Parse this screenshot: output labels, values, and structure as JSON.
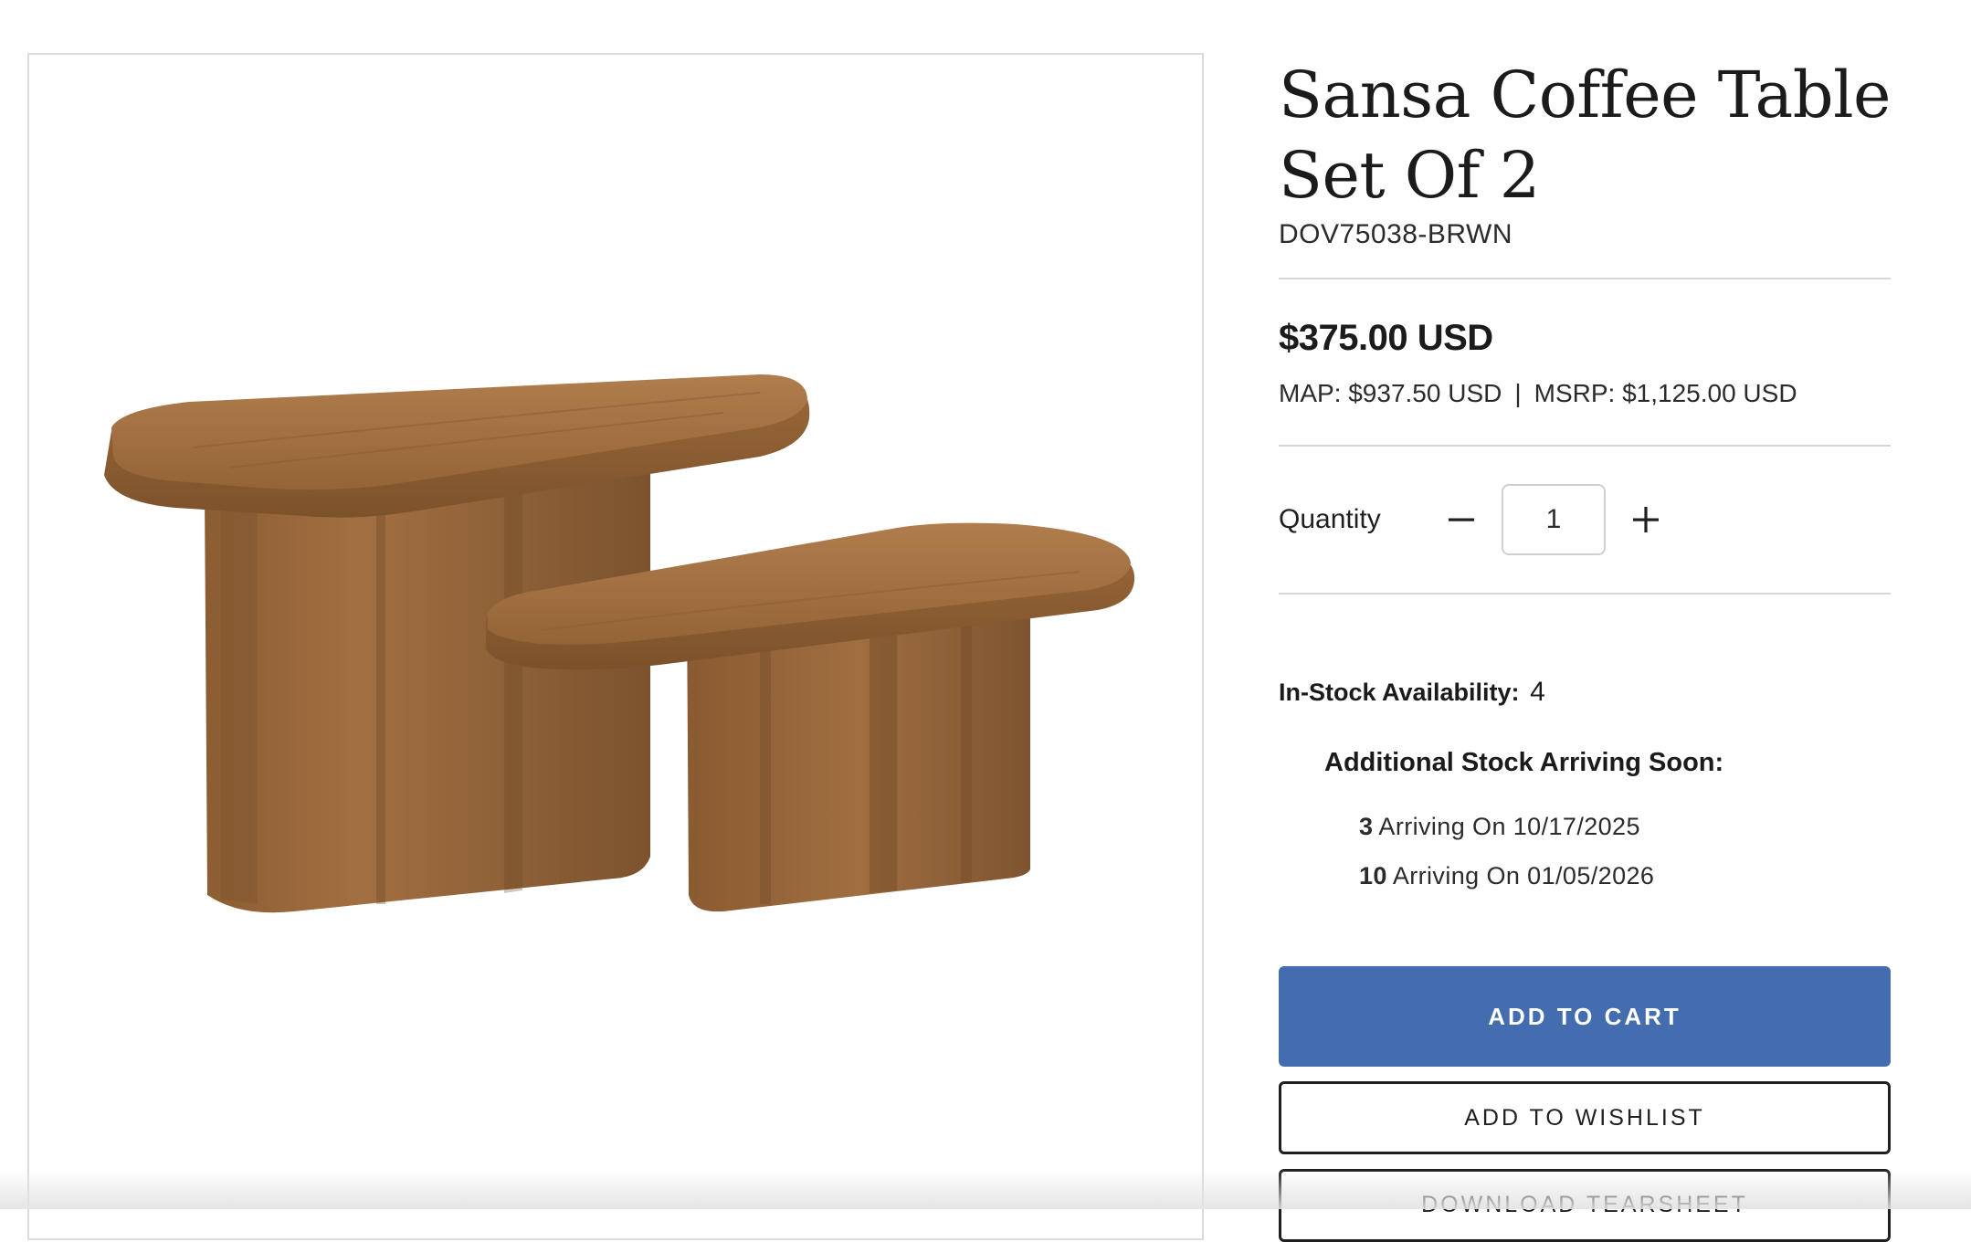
{
  "product": {
    "title": "Sansa Coffee Table Set Of 2",
    "sku": "DOV75038-BRWN",
    "price": "$375.00 USD",
    "map_price": "MAP: $937.50 USD",
    "separator": "|",
    "msrp_price": "MSRP: $1,125.00 USD"
  },
  "quantity": {
    "label": "Quantity",
    "value": "1",
    "decrease_icon": "minus-icon",
    "increase_icon": "plus-icon"
  },
  "stock": {
    "label": "In-Stock Availability:",
    "count": "4",
    "arriving_title": "Additional Stock Arriving Soon:",
    "arrivals": [
      {
        "qty": "3",
        "text": "Arriving On 10/17/2025"
      },
      {
        "qty": "10",
        "text": "Arriving On 01/05/2026"
      }
    ]
  },
  "actions": {
    "add_to_cart": "ADD TO CART",
    "add_to_wishlist": "ADD TO WISHLIST",
    "download_tearsheet": "DOWNLOAD TEARSHEET"
  },
  "colors": {
    "accent": "#436dae",
    "wood": "#9b6a3c"
  }
}
